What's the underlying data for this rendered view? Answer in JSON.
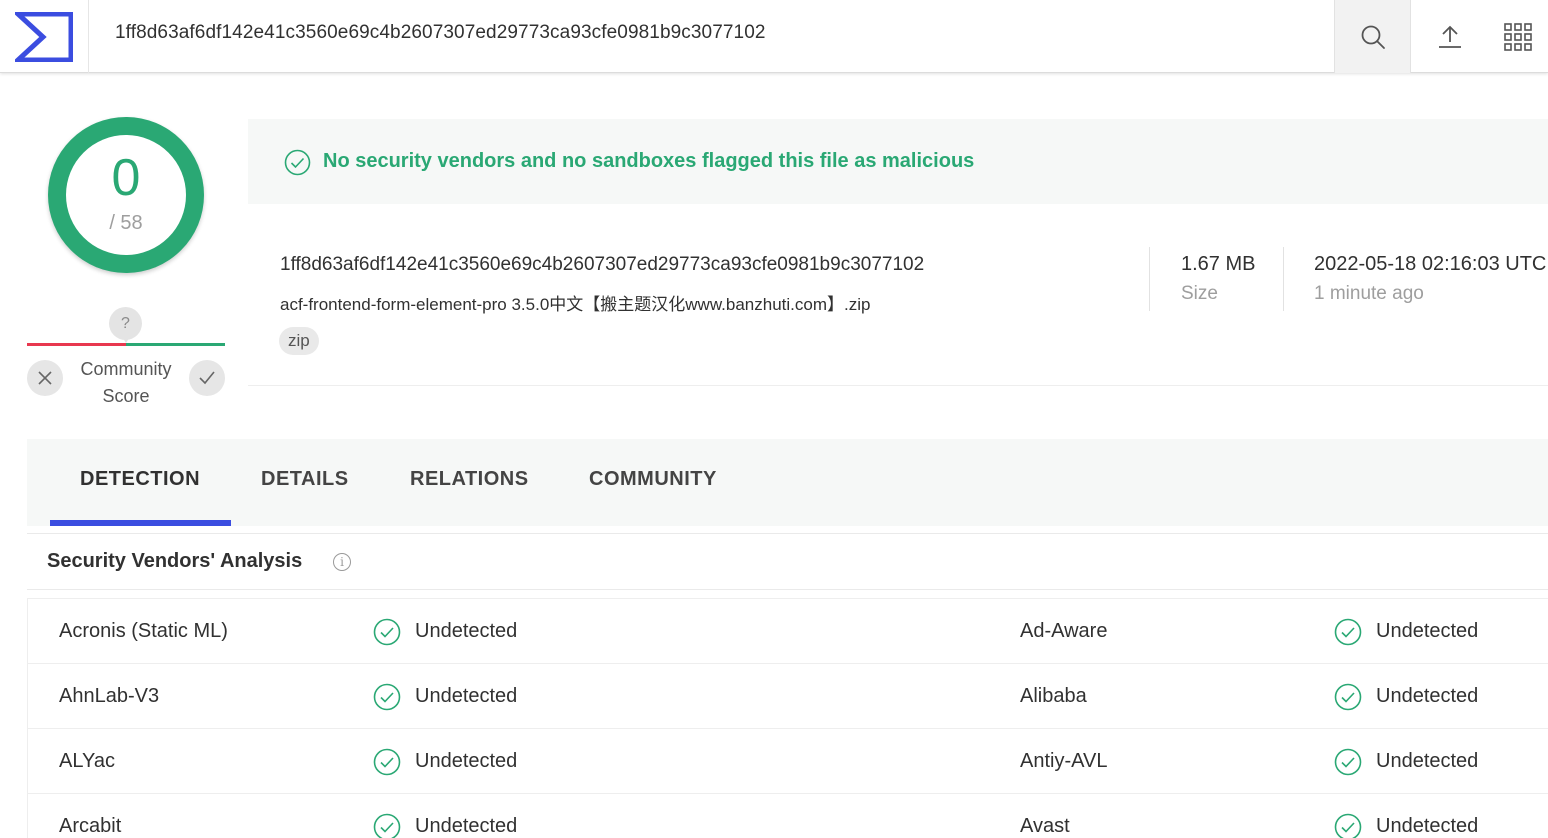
{
  "topbar": {
    "search_value": "1ff8d63af6df142e41c3560e69c4b2607307ed29773ca93cfe0981b9c3077102",
    "logo_icon": "virustotal-sigma-logo",
    "search_icon": "search-icon",
    "upload_icon": "upload-icon",
    "apps_icon": "apps-grid-icon"
  },
  "score": {
    "value": "0",
    "total": "/ 58",
    "color": "#2aa874"
  },
  "community": {
    "question": "?",
    "label": "Community Score"
  },
  "banner": {
    "text": "No security vendors and no sandboxes flagged this file as malicious",
    "color": "#2aa874"
  },
  "file": {
    "hash": "1ff8d63af6df142e41c3560e69c4b2607307ed29773ca93cfe0981b9c3077102",
    "name": "acf-frontend-form-element-pro 3.5.0中文【搬主题汉化www.banzhuti.com】.zip",
    "tag": "zip",
    "size_value": "1.67 MB",
    "size_label": "Size",
    "date_value": "2022-05-18 02:16:03 UTC",
    "date_label": "1 minute ago"
  },
  "tabs": [
    {
      "label": "DETECTION",
      "active": true
    },
    {
      "label": "DETAILS",
      "active": false
    },
    {
      "label": "RELATIONS",
      "active": false
    },
    {
      "label": "COMMUNITY",
      "active": false
    }
  ],
  "section": {
    "title": "Security Vendors' Analysis",
    "info": "i"
  },
  "vendors": [
    {
      "left_name": "Acronis (Static ML)",
      "left_result": "Undetected",
      "right_name": "Ad-Aware",
      "right_result": "Undetected"
    },
    {
      "left_name": "AhnLab-V3",
      "left_result": "Undetected",
      "right_name": "Alibaba",
      "right_result": "Undetected"
    },
    {
      "left_name": "ALYac",
      "left_result": "Undetected",
      "right_name": "Antiy-AVL",
      "right_result": "Undetected"
    },
    {
      "left_name": "Arcabit",
      "left_result": "Undetected",
      "right_name": "Avast",
      "right_result": "Undetected"
    }
  ],
  "colors": {
    "accent_blue": "#3b4de0",
    "clean_green": "#2aa874",
    "negative_red": "#e8384f"
  }
}
